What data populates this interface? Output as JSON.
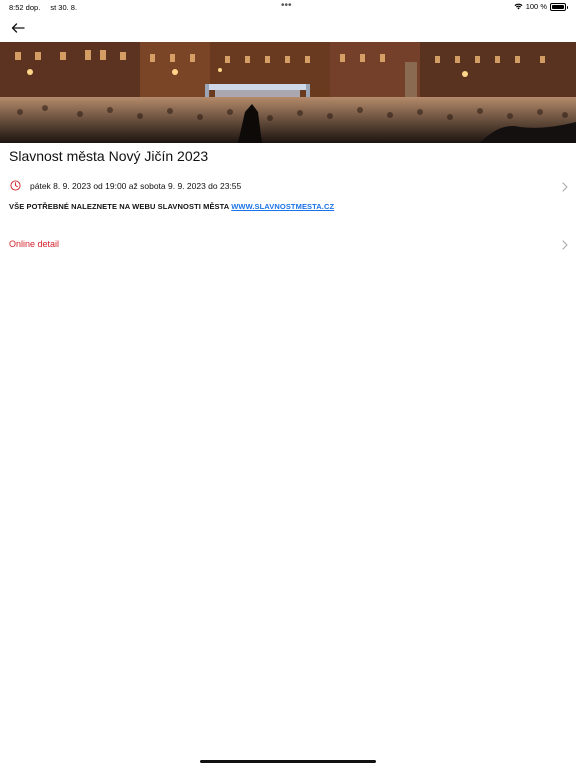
{
  "status_bar": {
    "time": "8:52 dop.",
    "date": "st 30. 8.",
    "dots": "•••",
    "battery_text": "100 %"
  },
  "nav": {
    "back_icon": "arrow-left-icon"
  },
  "hero": {
    "image_description": "Crowd at night concert in town square"
  },
  "event": {
    "title": "Slavnost města Nový Jičín 2023",
    "datetime": "pátek 8. 9. 2023 od 19:00 až sobota 9. 9. 2023 do 23:55",
    "info_prefix": "VŠE POTŘEBNÉ NALEZNETE NA WEBU SLAVNOSTI MĚSTA",
    "info_link": "WWW.SLAVNOSTMESTA.CZ",
    "online_detail_label": "Online detail"
  },
  "colors": {
    "accent_red": "#d3222a",
    "link_blue": "#1a73e8"
  }
}
